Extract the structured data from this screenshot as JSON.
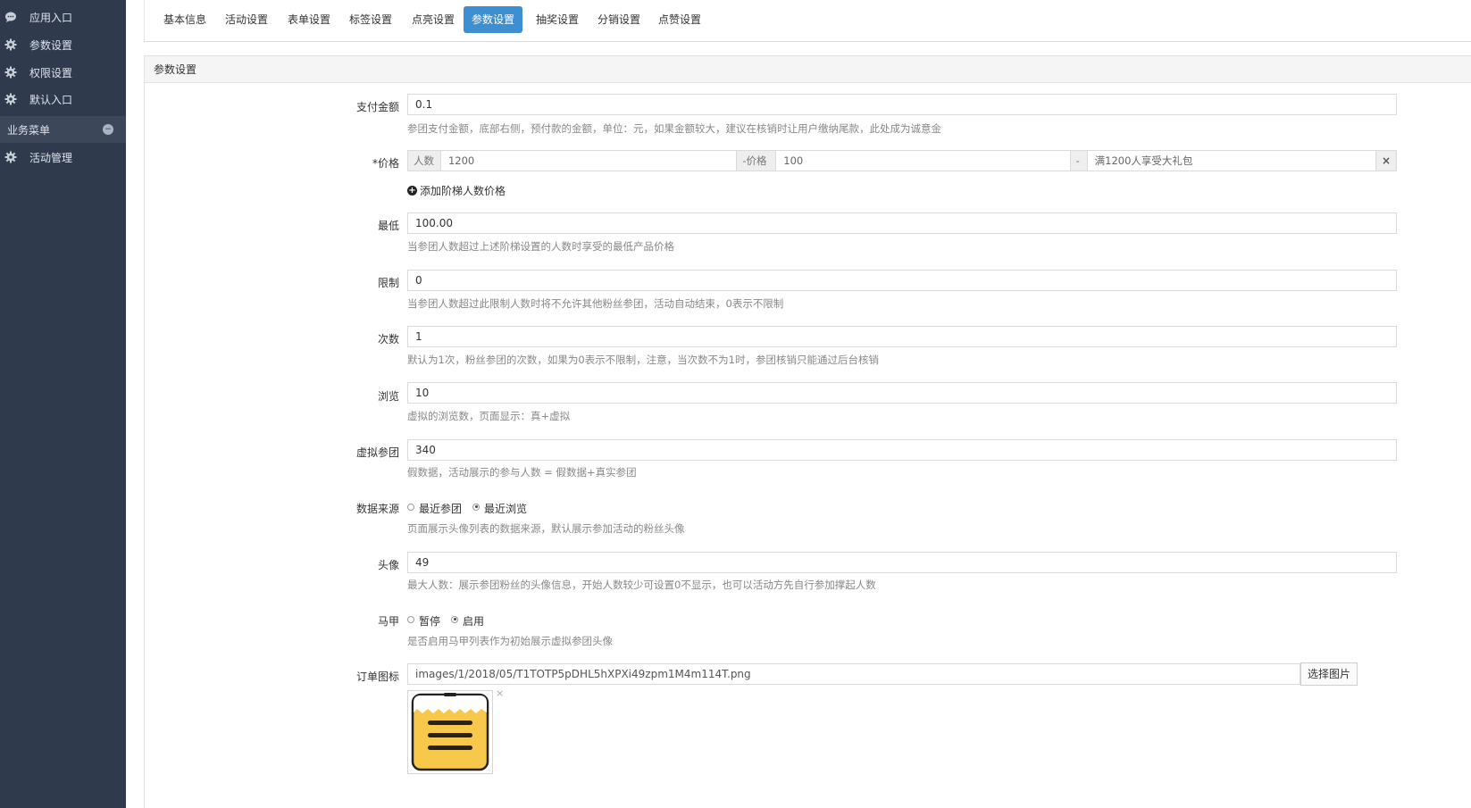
{
  "sidebar": {
    "items": [
      {
        "icon": "chat-icon",
        "label": "应用入口"
      },
      {
        "icon": "gear-icon",
        "label": "参数设置"
      },
      {
        "icon": "gear-icon",
        "label": "权限设置"
      },
      {
        "icon": "gear-icon",
        "label": "默认入口"
      }
    ],
    "section": {
      "label": "业务菜单",
      "toggle": "−"
    },
    "section_items": [
      {
        "icon": "gear-icon",
        "label": "活动管理"
      }
    ]
  },
  "tabs": [
    {
      "label": "基本信息"
    },
    {
      "label": "活动设置"
    },
    {
      "label": "表单设置"
    },
    {
      "label": "标签设置"
    },
    {
      "label": "点亮设置"
    },
    {
      "label": "参数设置",
      "active": true
    },
    {
      "label": "抽奖设置"
    },
    {
      "label": "分销设置"
    },
    {
      "label": "点赞设置"
    }
  ],
  "panel": {
    "title": "参数设置",
    "pay_amount": {
      "label": "支付金额",
      "value": "0.1",
      "help": "参团支付金额，底部右侧，预付款的金额，单位：元，如果金额较大，建议在核销时让用户缴纳尾款，此处成为诚意金"
    },
    "price": {
      "label": "*价格",
      "people_addon": "人数",
      "people_value": "1200",
      "price_addon": "-价格",
      "price_value": "100",
      "desc_addon": "-",
      "desc_value": "满1200人享受大礼包",
      "remove": "×",
      "add_tier": "添加阶梯人数价格"
    },
    "min": {
      "label": "最低",
      "value": "100.00",
      "help": "当参团人数超过上述阶梯设置的人数时享受的最低产品价格"
    },
    "limit": {
      "label": "限制",
      "value": "0",
      "help": "当参团人数超过此限制人数时将不允许其他粉丝参团，活动自动结束，0表示不限制"
    },
    "times": {
      "label": "次数",
      "value": "1",
      "help": "默认为1次，粉丝参团的次数，如果为0表示不限制，注意，当次数不为1时，参团核销只能通过后台核销"
    },
    "views": {
      "label": "浏览",
      "value": "10",
      "help": "虚拟的浏览数，页面显示：真+虚拟"
    },
    "virtual": {
      "label": "虚拟参团",
      "value": "340",
      "help": "假数据，活动展示的参与人数 = 假数据+真实参团"
    },
    "source": {
      "label": "数据来源",
      "options": [
        "最近参团",
        "最近浏览"
      ],
      "selected": "最近浏览",
      "help": "页面展示头像列表的数据来源，默认展示参加活动的粉丝头像"
    },
    "avatar": {
      "label": "头像",
      "value": "49",
      "help": "最大人数：展示参团粉丝的头像信息，开始人数较少可设置0不显示，也可以活动方先自行参加撑起人数"
    },
    "vest": {
      "label": "马甲",
      "options": [
        "暂停",
        "启用"
      ],
      "selected": "启用",
      "help": "是否启用马甲列表作为初始展示虚拟参团头像"
    },
    "order_icon": {
      "label": "订单图标",
      "value": "images/1/2018/05/T1TOTP5pDHL5hXPXi49zpm1M4m114T.png",
      "button": "选择图片",
      "remove": "×"
    }
  },
  "colors": {
    "sidebar": "#2f3a4d",
    "accent": "#3d8fd1",
    "thumb_yellow": "#f8c84a"
  }
}
